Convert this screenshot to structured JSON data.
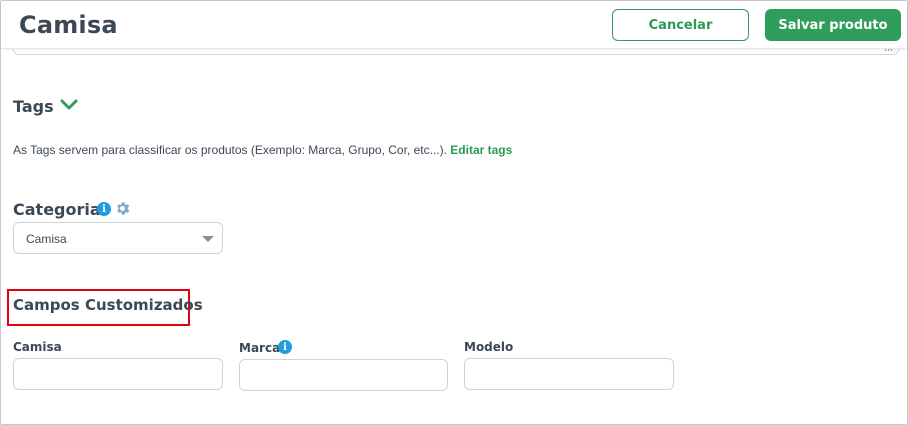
{
  "header": {
    "title": "Camisa",
    "cancel_label": "Cancelar",
    "save_label": "Salvar produto"
  },
  "tags": {
    "title": "Tags",
    "description": "As Tags servem para classificar os produtos (Exemplo: Marca, Grupo, Cor, etc...).",
    "edit_link": "Editar tags"
  },
  "categoria": {
    "title": "Categoria",
    "info_icon": "i",
    "selected": "Camisa"
  },
  "custom_fields": {
    "title": "Campos Customizados",
    "fields": [
      {
        "label": "Camisa",
        "value": ""
      },
      {
        "label": "Marca",
        "value": "",
        "info_icon": "i"
      },
      {
        "label": "Modelo",
        "value": ""
      }
    ]
  },
  "colors": {
    "accent": "#2f9e5b",
    "info": "#1e9ce0",
    "highlight": "#e3000f"
  }
}
